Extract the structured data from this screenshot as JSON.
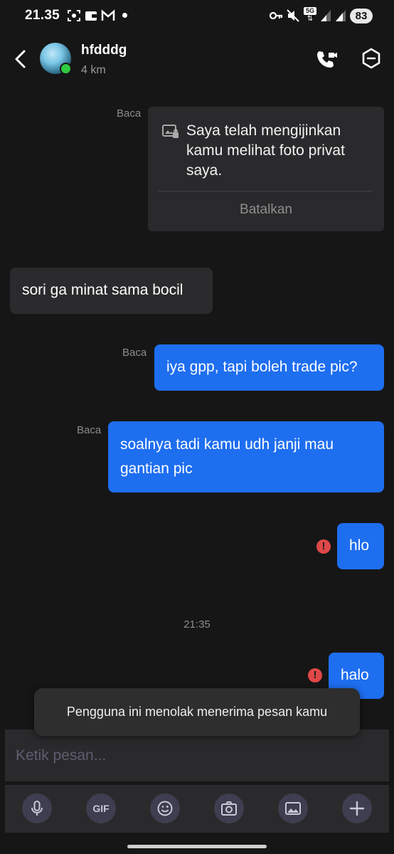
{
  "status_bar": {
    "time": "21.35",
    "network": "5G",
    "battery": "83"
  },
  "header": {
    "contact_name": "hfdddg",
    "distance": "4 km"
  },
  "messages": [
    {
      "type": "photo_permission",
      "read": "Baca",
      "text": "Saya telah mengijinkan kamu melihat foto privat saya.",
      "action": "Batalkan"
    },
    {
      "type": "incoming",
      "text": "sori ga minat sama bocil"
    },
    {
      "type": "outgoing",
      "read": "Baca",
      "text": "iya gpp, tapi boleh trade pic?"
    },
    {
      "type": "outgoing",
      "read": "Baca",
      "text": "soalnya tadi kamu udh janji mau gantian pic"
    },
    {
      "type": "outgoing",
      "status": "error",
      "text": "hlo"
    },
    {
      "type": "outgoing",
      "status": "error",
      "text": "halo"
    }
  ],
  "error_icon": "!",
  "timestamp": "21:35",
  "toast": "Pengguna ini menolak menerima pesan kamu",
  "input": {
    "placeholder": "Ketik pesan..."
  },
  "toolbar": {
    "gif_label": "GIF",
    "icons": [
      "microphone-icon",
      "gif-icon",
      "emoji-icon",
      "camera-icon",
      "gallery-icon",
      "plus-icon"
    ]
  },
  "colors": {
    "background": "#161616",
    "outgoing_bubble": "#1e6ef0",
    "incoming_bubble": "#2b2b2d",
    "error": "#e04848",
    "online": "#2ecc40"
  }
}
